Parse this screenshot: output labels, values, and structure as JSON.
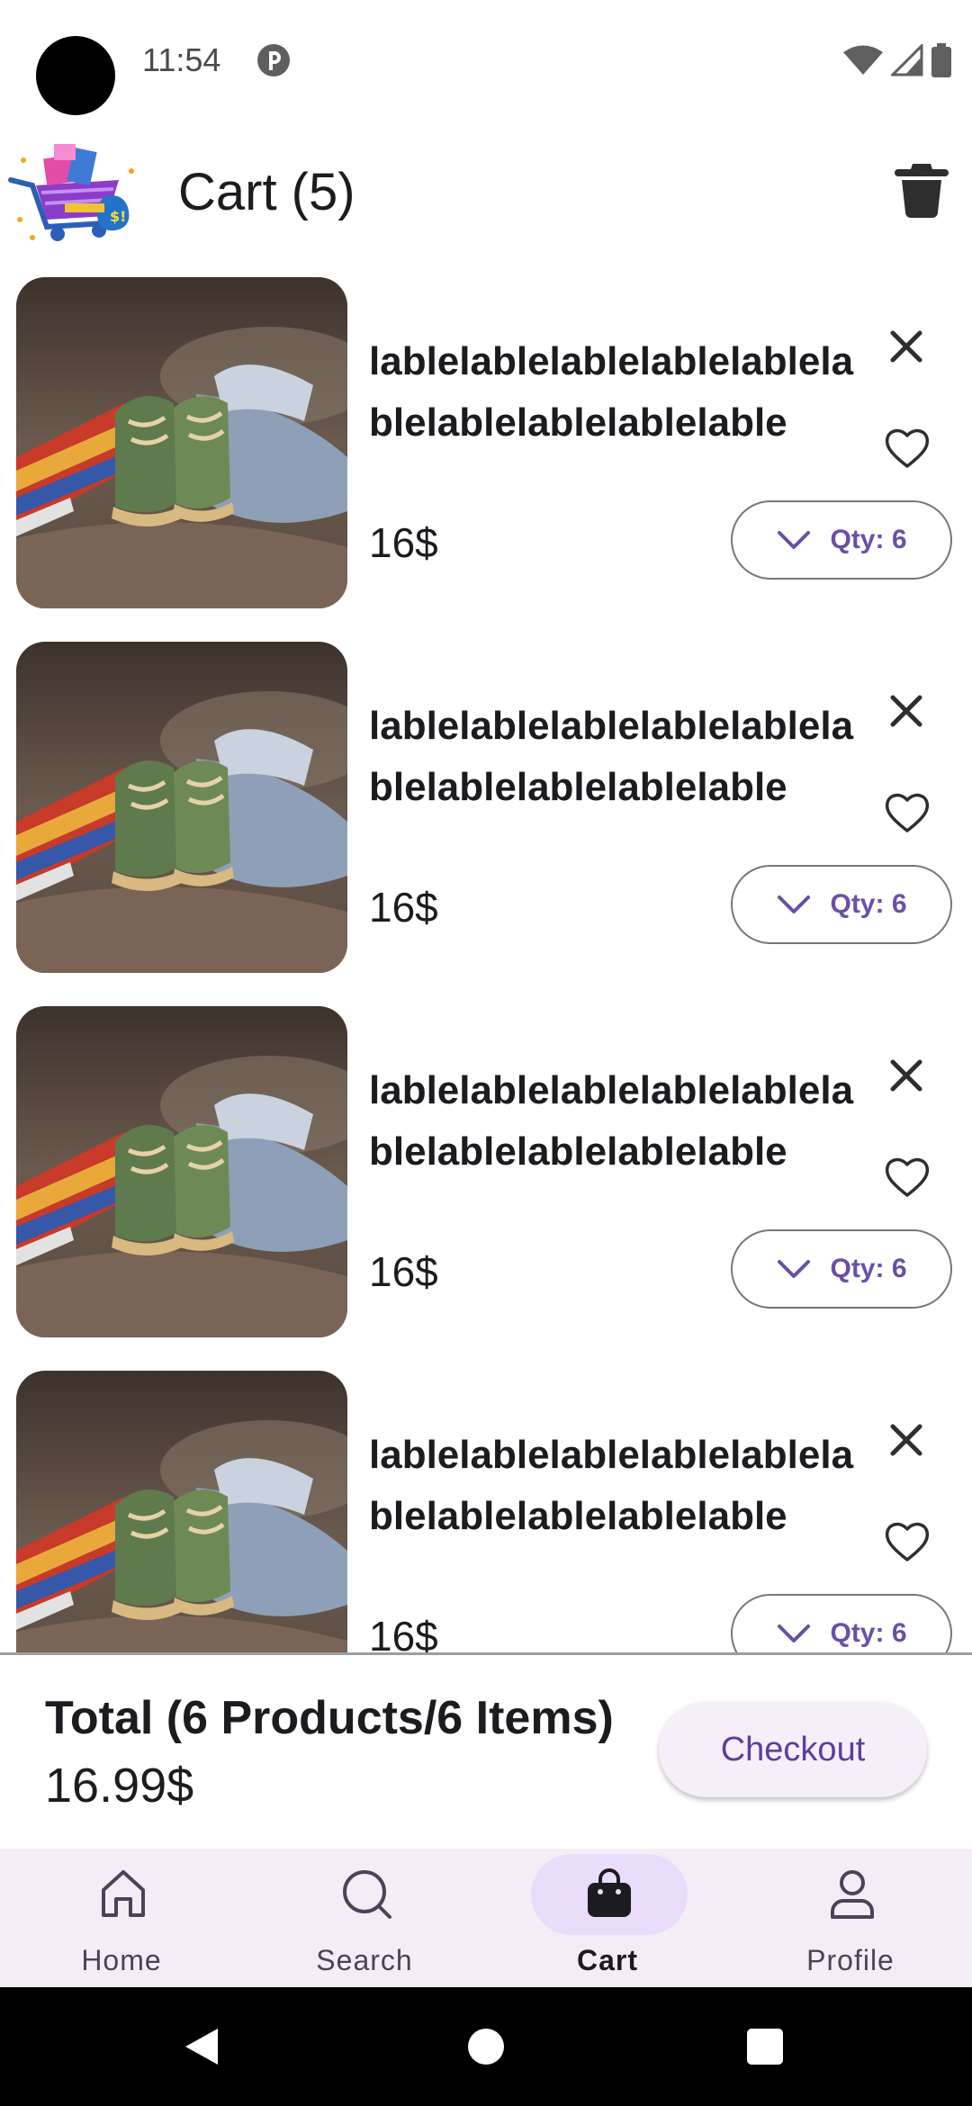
{
  "status_bar": {
    "time": "11:54"
  },
  "header": {
    "title": "Cart (5)"
  },
  "items": [
    {
      "name": "lablelablelablelablelablelablelablelablelablelable",
      "price": "16$",
      "qty_label": "Qty: 6"
    },
    {
      "name": "lablelablelablelablelablelablelablelablelablelable",
      "price": "16$",
      "qty_label": "Qty: 6"
    },
    {
      "name": "lablelablelablelablelablelablelablelablelablelable",
      "price": "16$",
      "qty_label": "Qty: 6"
    },
    {
      "name": "lablelablelablelablelablelablelablelablelablelable",
      "price": "16$",
      "qty_label": "Qty: 6"
    }
  ],
  "summary": {
    "total_label": "Total (6 Products/6 Items)",
    "total_amount": "16.99$",
    "checkout_label": "Checkout"
  },
  "nav": {
    "items": [
      {
        "label": "Home",
        "icon": "home-icon"
      },
      {
        "label": "Search",
        "icon": "search-icon"
      },
      {
        "label": "Cart",
        "icon": "shopping-bag-icon",
        "active": true
      },
      {
        "label": "Profile",
        "icon": "person-icon"
      }
    ]
  },
  "colors": {
    "accent": "#6a4fa8",
    "nav_background": "#f3eef6",
    "active_indicator": "#e9ddfb",
    "checkout_background": "#f4eff9"
  }
}
